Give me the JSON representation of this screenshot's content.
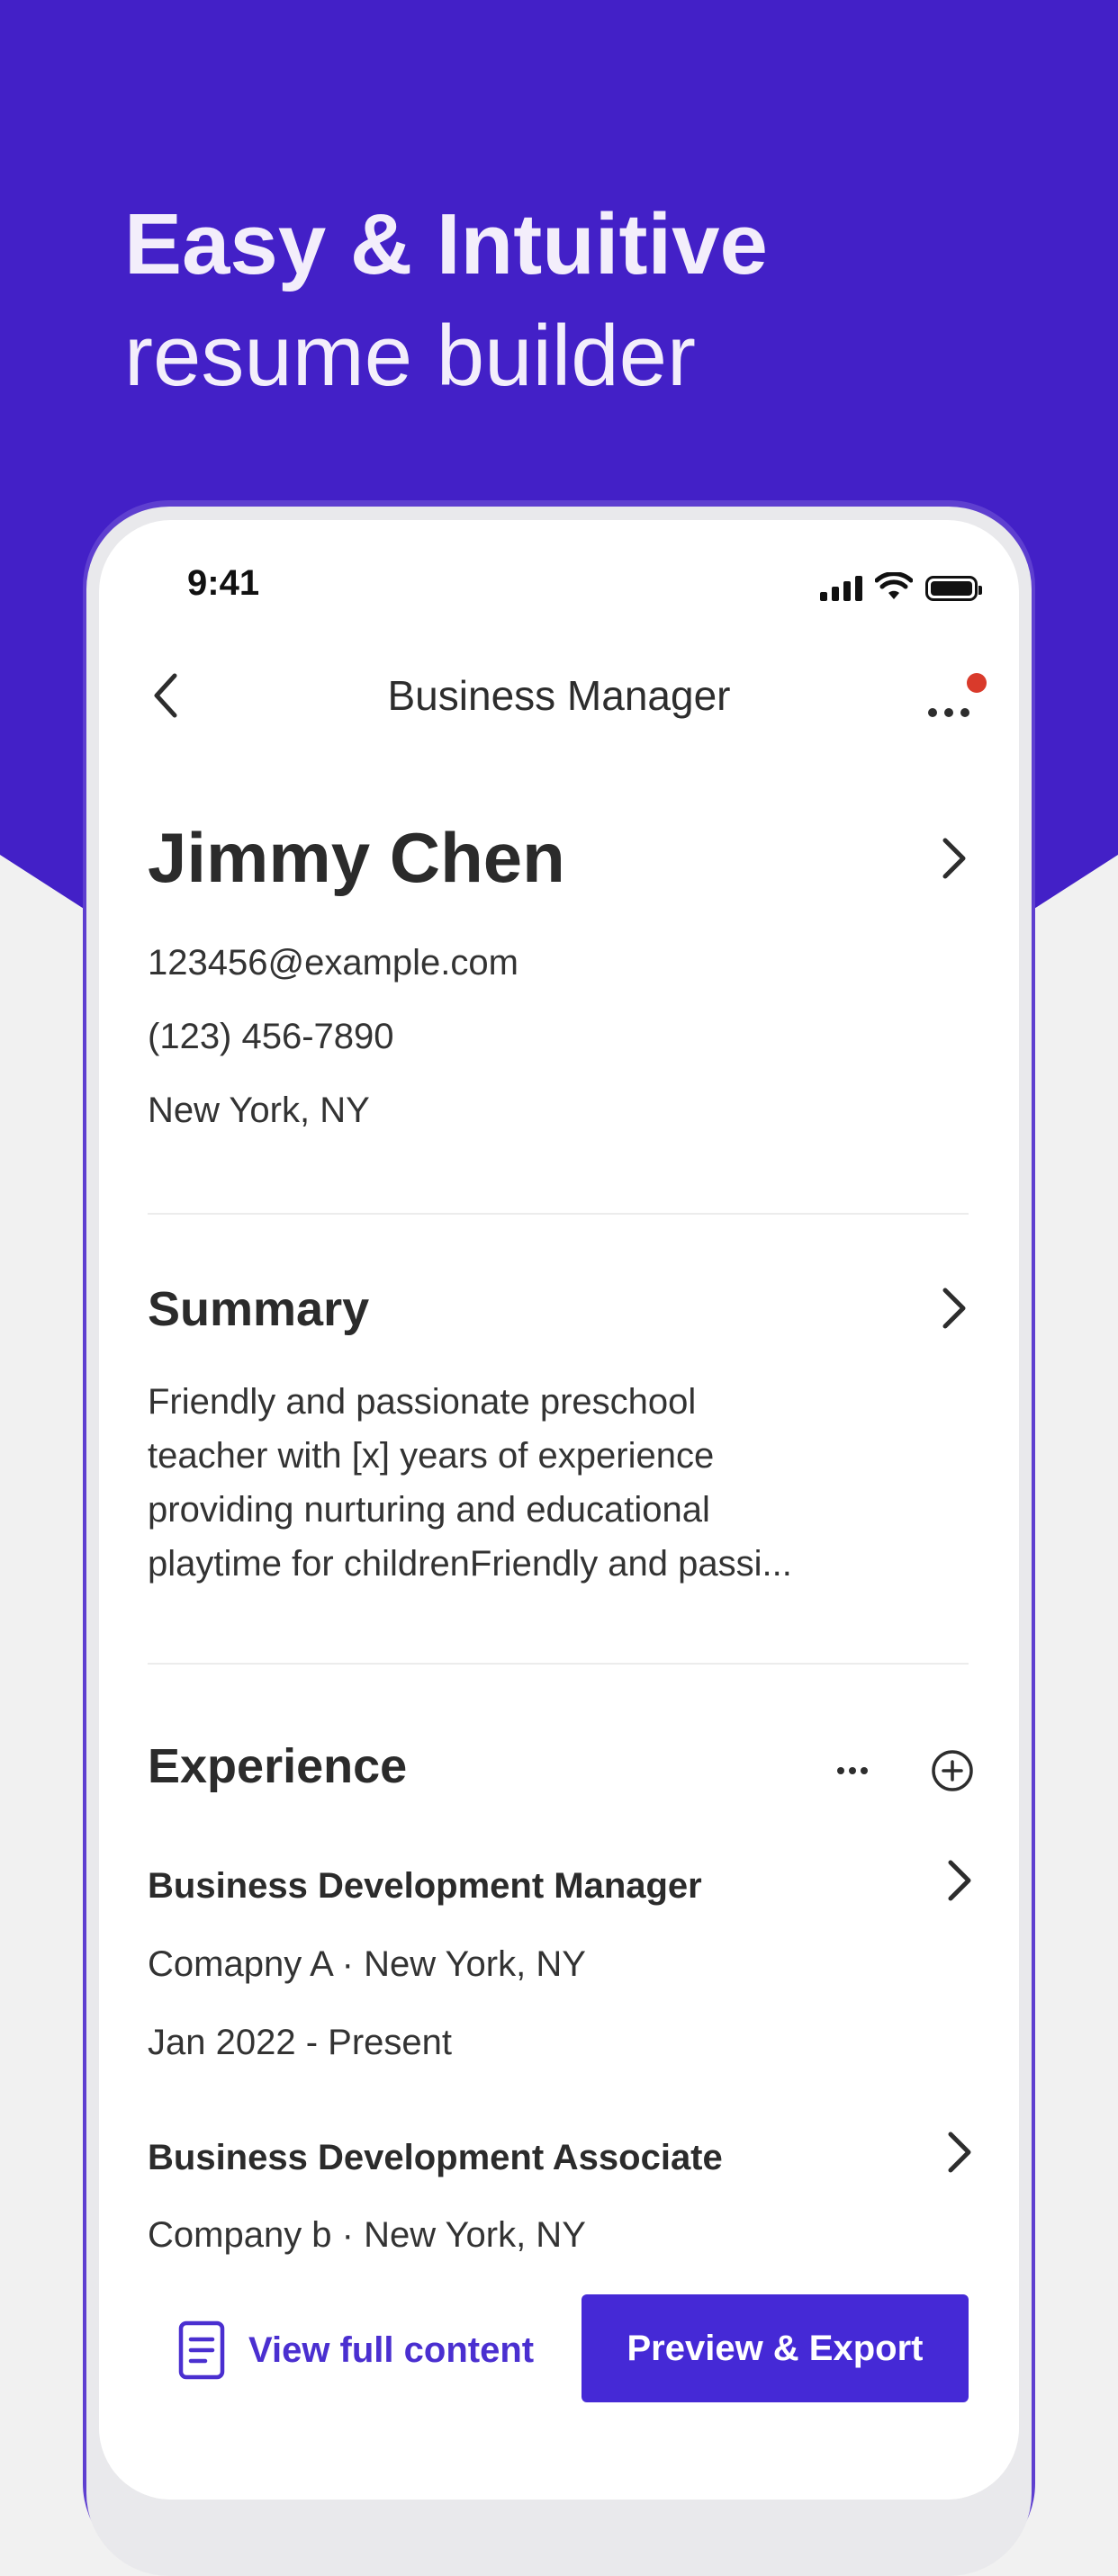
{
  "hero": {
    "line1": "Easy & Intuitive",
    "line2": "resume builder"
  },
  "status_bar": {
    "time": "9:41"
  },
  "nav": {
    "title": "Business Manager",
    "back_icon": "chevron-left-icon",
    "more_icon": "more-horizontal-icon",
    "has_notification": true
  },
  "profile": {
    "name": "Jimmy Chen",
    "email": "123456@example.com",
    "phone": "(123) 456-7890",
    "location": "New York, NY"
  },
  "summary": {
    "title": "Summary",
    "lines": [
      "Friendly and passionate preschool",
      "teacher with [x] years of experience",
      "providing nurturing and educational",
      "playtime for childrenFriendly and passi..."
    ]
  },
  "experience": {
    "title": "Experience",
    "items": [
      {
        "title": "Business Development Manager",
        "company_location": "Comapny A · New York, NY",
        "dates": "Jan 2022 - Present"
      },
      {
        "title": "Business Development Associate",
        "company_location": "Company b · New York, NY"
      }
    ]
  },
  "actions": {
    "view_full": "View full content",
    "preview_export": "Preview & Export"
  },
  "colors": {
    "brand": "#4320c7",
    "button": "#4529d6",
    "link": "#4a2fd0",
    "notification": "#d93a2b"
  }
}
